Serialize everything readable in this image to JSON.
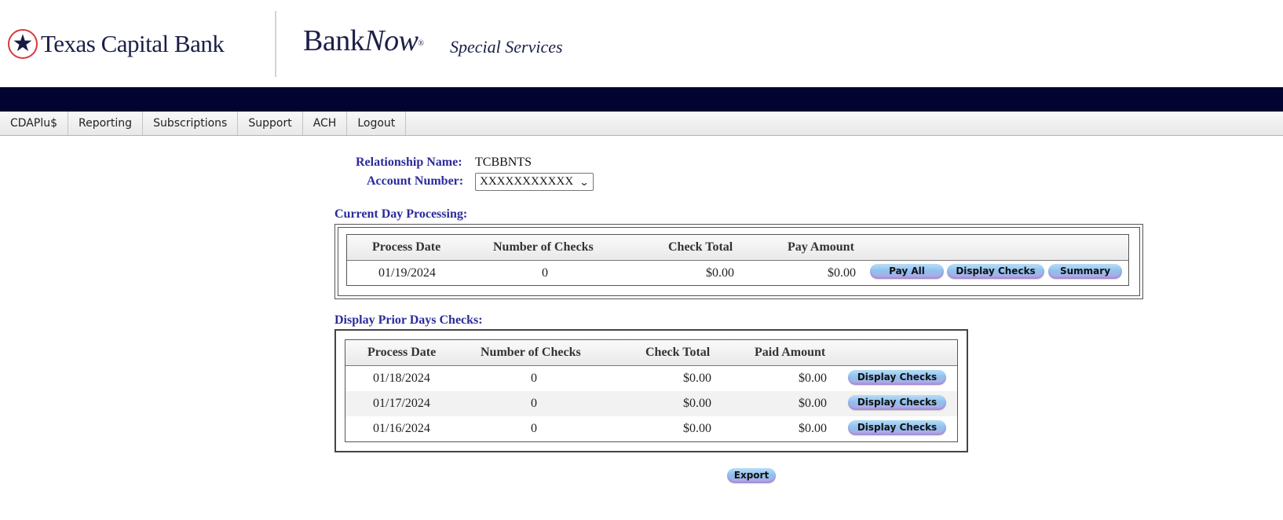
{
  "header": {
    "bank_name": "Texas Capital Bank",
    "product_bank": "Bank",
    "product_now": "Now",
    "product_reg": "®",
    "product_subtitle": "Special Services",
    "star_icon": "★"
  },
  "nav": {
    "items": [
      {
        "label": "CDAPlu$"
      },
      {
        "label": "Reporting"
      },
      {
        "label": "Subscriptions"
      },
      {
        "label": "Support"
      },
      {
        "label": "ACH"
      },
      {
        "label": "Logout"
      }
    ]
  },
  "account": {
    "relationship_label": "Relationship Name:",
    "relationship_value": "TCBBNTS",
    "account_label": "Account Number:",
    "account_selected": "XXXXXXXXXXX",
    "chevron": "❯"
  },
  "current_day": {
    "title": "Current Day Processing:",
    "columns": [
      "Process Date",
      "Number of Checks",
      "Check Total",
      "Pay Amount"
    ],
    "row": {
      "process_date": "01/19/2024",
      "number_of_checks": "0",
      "check_total": "$0.00",
      "pay_amount": "$0.00"
    },
    "buttons": {
      "pay_all": "Pay All",
      "display_checks": "Display Checks",
      "summary": "Summary"
    }
  },
  "prior_days": {
    "title": "Display Prior Days Checks:",
    "columns": [
      "Process Date",
      "Number of Checks",
      "Check Total",
      "Paid Amount"
    ],
    "rows": [
      {
        "process_date": "01/18/2024",
        "number_of_checks": "0",
        "check_total": "$0.00",
        "paid_amount": "$0.00",
        "button": "Display Checks"
      },
      {
        "process_date": "01/17/2024",
        "number_of_checks": "0",
        "check_total": "$0.00",
        "paid_amount": "$0.00",
        "button": "Display Checks"
      },
      {
        "process_date": "01/16/2024",
        "number_of_checks": "0",
        "check_total": "$0.00",
        "paid_amount": "$0.00",
        "button": "Display Checks"
      }
    ]
  },
  "export_label": "Export",
  "colors": {
    "navy_bar": "#020330",
    "label_blue": "#2b2b9a",
    "logo_red": "#d8393c",
    "logo_navy": "#1b1f48"
  }
}
